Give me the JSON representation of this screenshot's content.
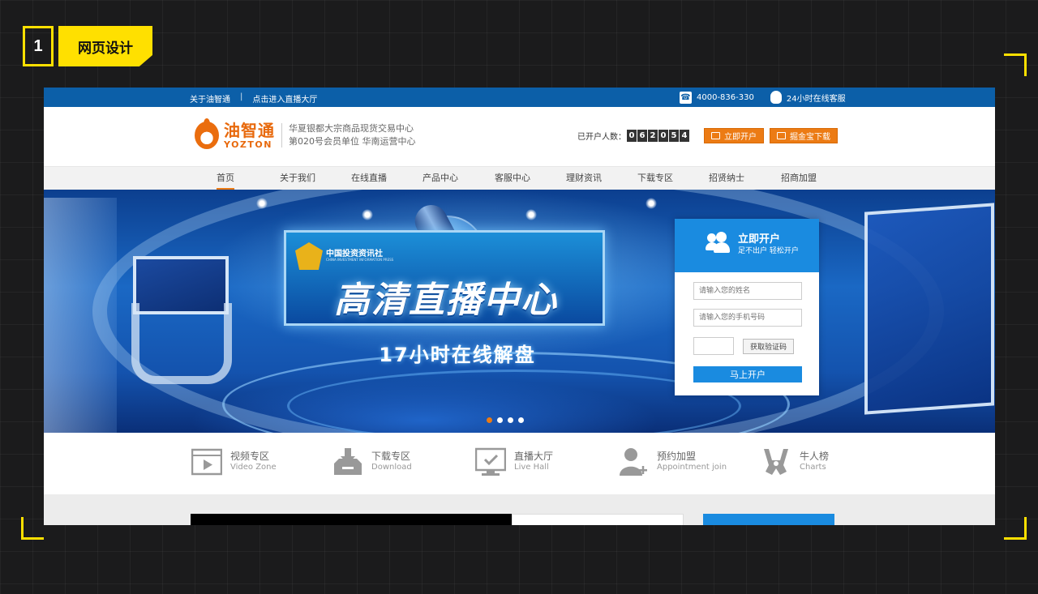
{
  "slide": {
    "number": "1",
    "title": "网页设计"
  },
  "topbar": {
    "about": "关于油智通",
    "separator": "|",
    "live_hall": "点击进入直播大厅",
    "phone": "4000-836-330",
    "service": "24小时在线客服"
  },
  "header": {
    "logo_cn": "油智通",
    "logo_en": "YOZTON",
    "slogan_line1": "华夏银都大宗商品现货交易中心",
    "slogan_line2": "第020号会员单位  华南运营中心",
    "counter_label": "已开户人数：",
    "counter_digits": [
      "0",
      "6",
      "2",
      "0",
      "5",
      "4"
    ],
    "open_account_button": "立即开户",
    "download_button": "掘金宝下载"
  },
  "nav": {
    "items": [
      {
        "label": "首页",
        "active": true
      },
      {
        "label": "关于我们"
      },
      {
        "label": "在线直播"
      },
      {
        "label": "产品中心"
      },
      {
        "label": "客服中心"
      },
      {
        "label": "理财资讯"
      },
      {
        "label": "下载专区"
      },
      {
        "label": "招贤纳士"
      },
      {
        "label": "招商加盟"
      }
    ]
  },
  "banner": {
    "press_name": "中国投资资讯社",
    "press_en": "CHINA INVESTMENT INFORMATION PRESS",
    "title": "高清直播中心",
    "subtitle": "17小时在线解盘",
    "slide_count": 4,
    "active_slide": 1
  },
  "signup": {
    "title": "立即开户",
    "subtitle": "足不出户 轻松开户",
    "name_placeholder": "请输入您的姓名",
    "phone_placeholder": "请输入您的手机号码",
    "code_button": "获取验证码",
    "submit_button": "马上开户"
  },
  "features": [
    {
      "cn": "视频专区",
      "en": "Video Zone",
      "icon": "video-icon"
    },
    {
      "cn": "下载专区",
      "en": "Download",
      "icon": "download-icon"
    },
    {
      "cn": "直播大厅",
      "en": "Live Hall",
      "icon": "monitor-icon"
    },
    {
      "cn": "预约加盟",
      "en": "Appointment join",
      "icon": "add-user-icon"
    },
    {
      "cn": "牛人榜",
      "en": "Charts",
      "icon": "trophy-icon"
    }
  ],
  "colors": {
    "brand_blue": "#0c5fa8",
    "accent_orange": "#ec7b14",
    "accent_yellow": "#ffe000",
    "button_blue": "#1a8be0"
  }
}
